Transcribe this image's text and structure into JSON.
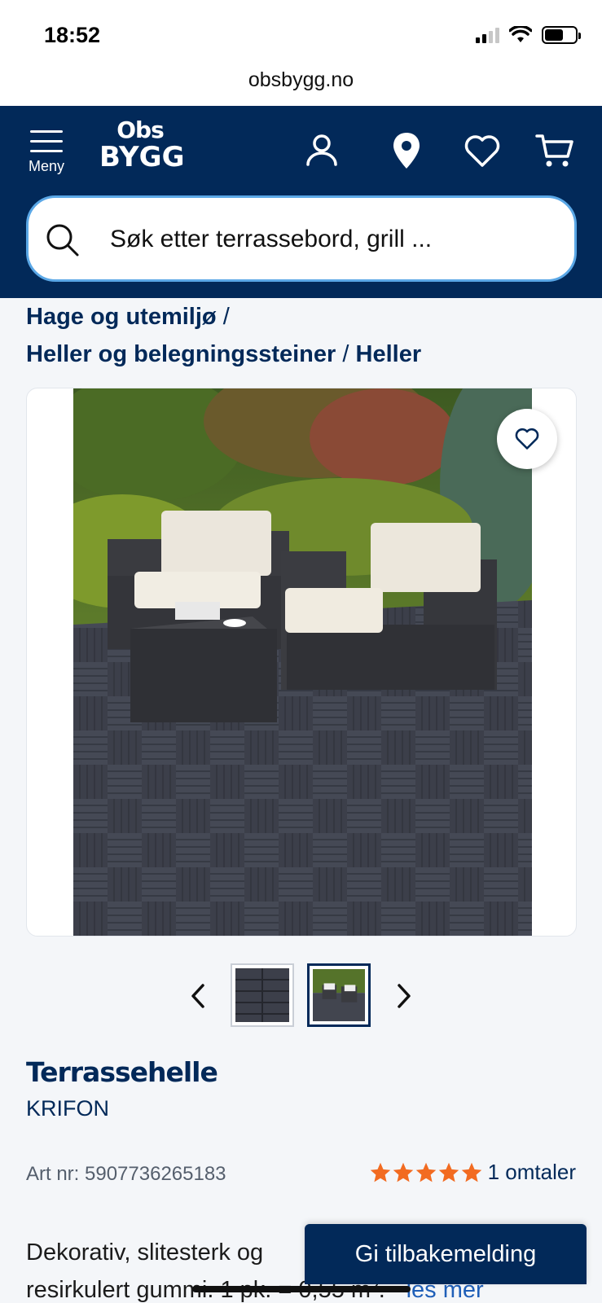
{
  "status_bar": {
    "time": "18:52"
  },
  "browser": {
    "url": "obsbygg.no"
  },
  "header": {
    "menu_label": "Meny",
    "logo_line1": "Obs",
    "logo_line2": "BYGG",
    "icons": [
      "user-icon",
      "location-pin-icon",
      "heart-icon",
      "cart-icon"
    ],
    "search_placeholder": "Søk etter terrassebord, grill ...",
    "brand_color": "#022959",
    "search_border_color": "#5aa7e6"
  },
  "breadcrumb": {
    "item1": "Hage og utemiljø",
    "item2": "Heller og belegningssteiner",
    "item3": "Heller",
    "separator": "/"
  },
  "gallery": {
    "thumbnail_count": 2,
    "active_thumbnail": 2
  },
  "product": {
    "title": "Terrassehelle",
    "brand": "KRIFON",
    "art_nr": "Art nr: 5907736265183",
    "rating_stars": 5,
    "rating_text": "1 omtaler",
    "star_color": "#f26b21",
    "description_line1": "Dekorativ, slitesterk og",
    "description_line2": "resirkulert gummi. 1 pk. = 0,55 m². -",
    "read_more": "les mer"
  },
  "feedback_button": "Gi tilbakemelding"
}
